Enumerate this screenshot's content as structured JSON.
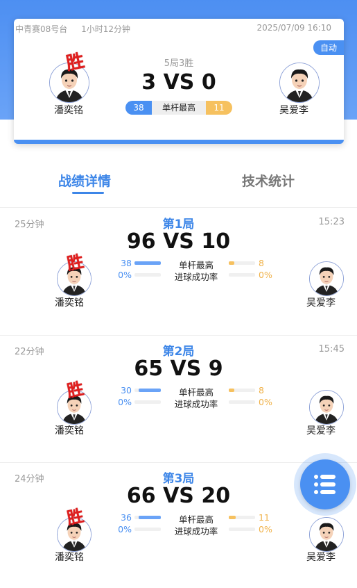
{
  "header": {
    "match_name": "中青赛08号台",
    "duration": "1小时12分钟",
    "datetime": "2025/07/09 16:10",
    "auto_badge": "自动",
    "format": "5局3胜",
    "score": "3 VS 0",
    "win_mark": "胜",
    "player_left": "潘奕铭",
    "player_right": "吴爱李",
    "highest_break_label": "单杆最高",
    "highest_break_left": "38",
    "highest_break_right": "11"
  },
  "tabs": {
    "active": "战绩详情",
    "inactive": "技术统计"
  },
  "games": [
    {
      "title": "第1局",
      "duration": "25分钟",
      "time": "15:23",
      "score": "96 VS 10",
      "win_mark": "胜",
      "player_left": "潘奕铭",
      "player_right": "吴爱李",
      "break_label": "单杆最高",
      "break_left": "38",
      "break_right": "8",
      "rate_label": "进球成功率",
      "rate_left": "0%",
      "rate_right": "0%"
    },
    {
      "title": "第2局",
      "duration": "22分钟",
      "time": "15:45",
      "score": "65 VS 9",
      "win_mark": "胜",
      "player_left": "潘奕铭",
      "player_right": "吴爱李",
      "break_label": "单杆最高",
      "break_left": "30",
      "break_right": "8",
      "rate_label": "进球成功率",
      "rate_left": "0%",
      "rate_right": "0%"
    },
    {
      "title": "第3局",
      "duration": "24分钟",
      "time": "",
      "score": "66 VS 20",
      "win_mark": "胜",
      "player_left": "潘奕铭",
      "player_right": "吴爱李",
      "break_label": "单杆最高",
      "break_left": "36",
      "break_right": "11",
      "rate_label": "进球成功率",
      "rate_left": "0%",
      "rate_right": "0%"
    }
  ],
  "fab_icon": "list-icon",
  "colors": {
    "primary": "#4a90f2",
    "accent_orange": "#f6c15f",
    "win_red": "#e01e1e"
  }
}
